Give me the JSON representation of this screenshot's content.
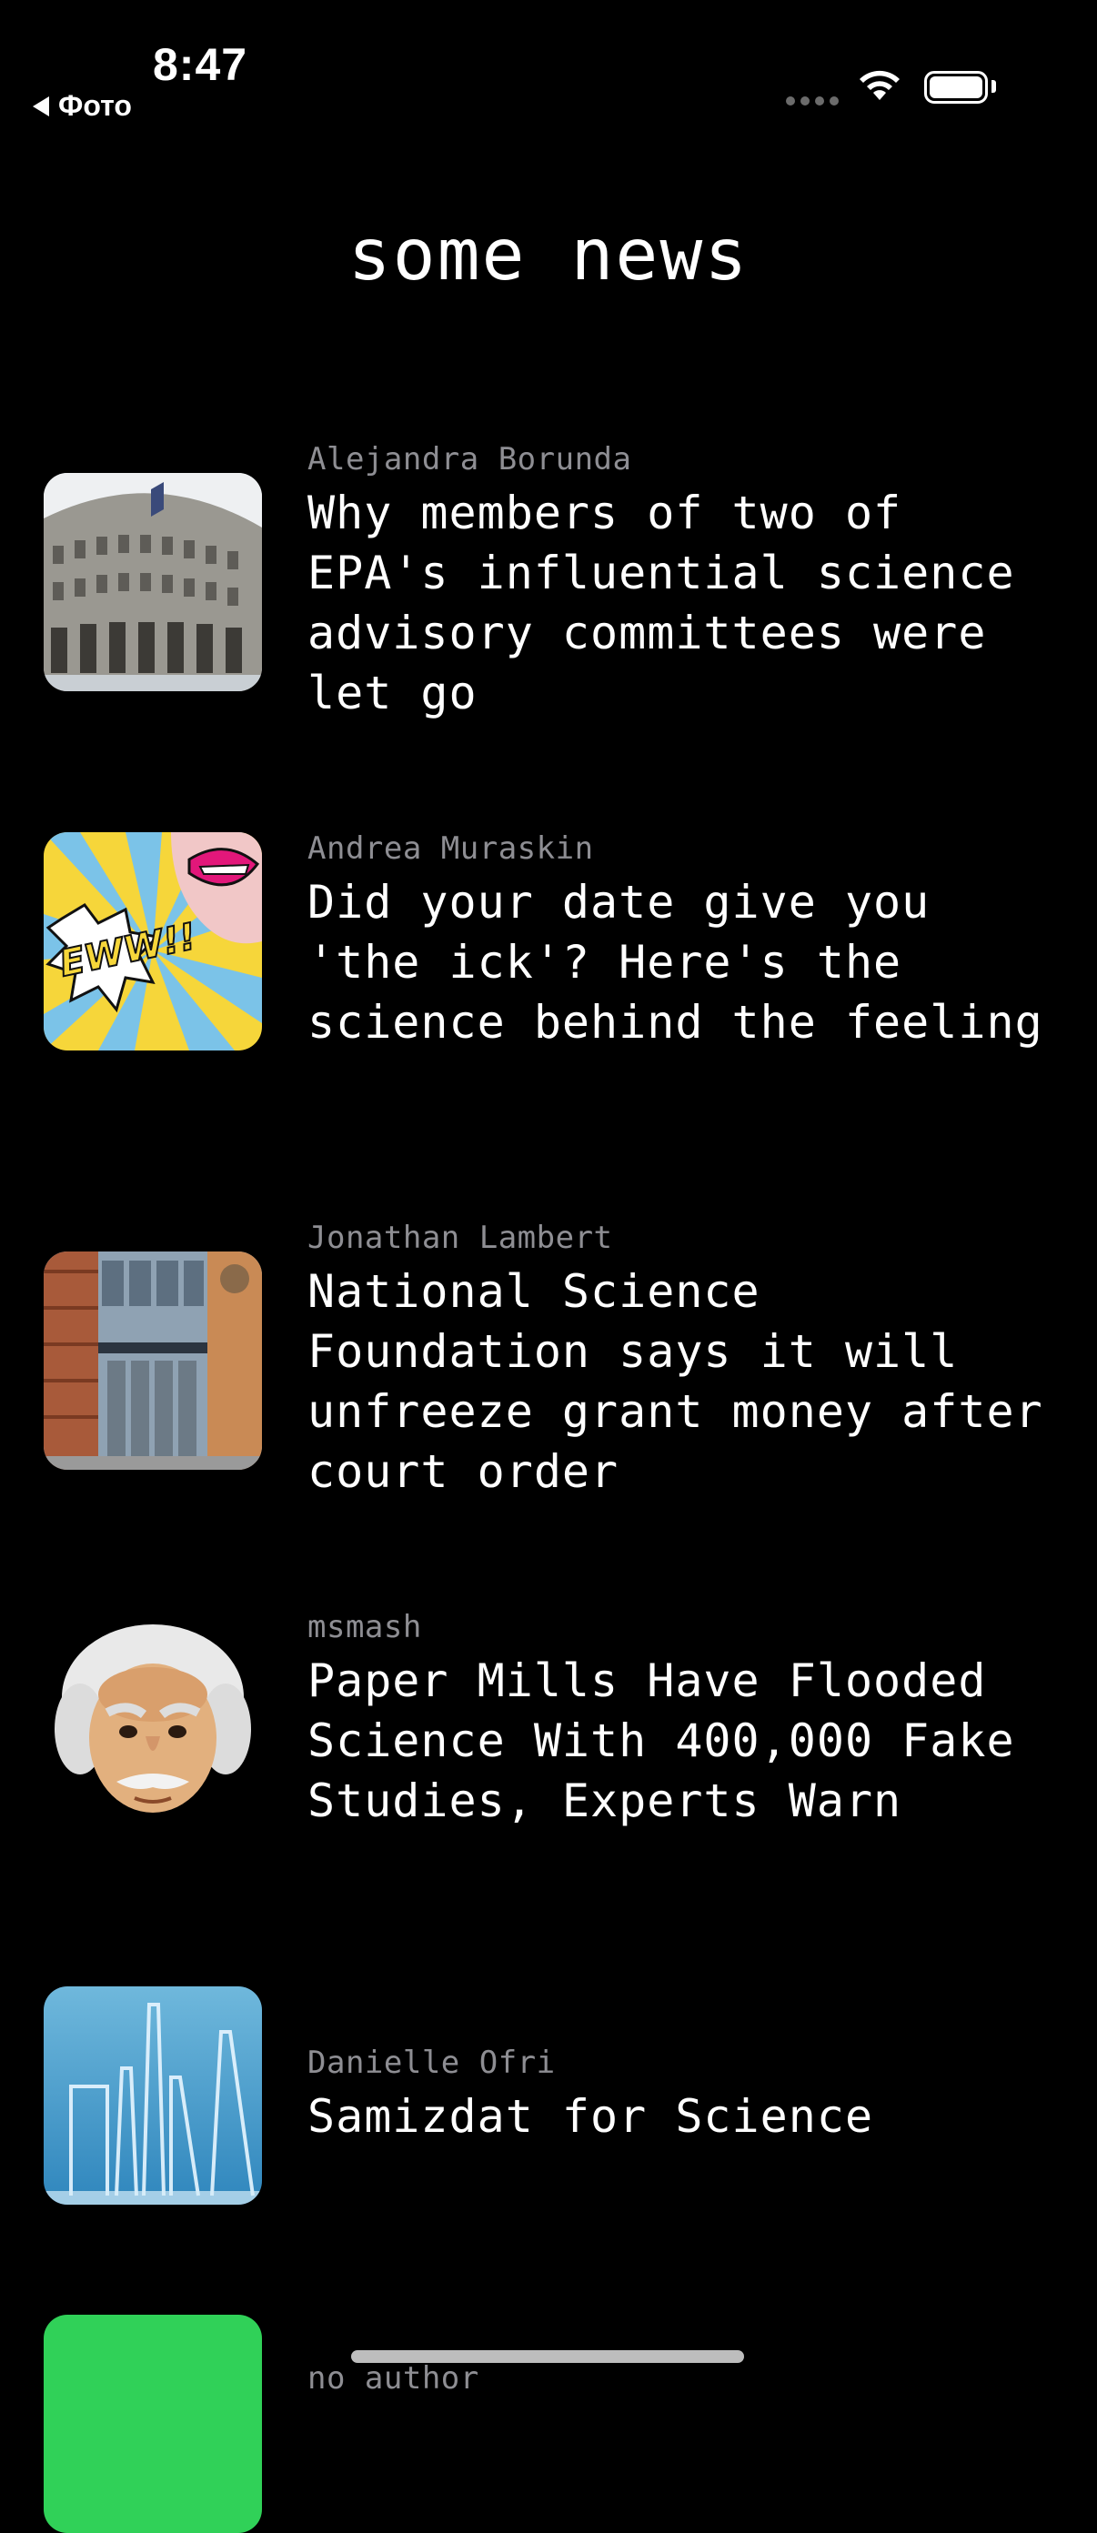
{
  "status_bar": {
    "time": "8:47",
    "back_label": "Фото",
    "icons": [
      "signal-dots-icon",
      "wifi-icon",
      "battery-icon"
    ]
  },
  "page": {
    "title": "some news"
  },
  "articles": [
    {
      "author": "Alejandra Borunda",
      "headline": "Why members of two of EPA's influential science advisory committees were let go",
      "thumbnail": "building-photo"
    },
    {
      "author": "Andrea Muraskin",
      "headline": "Did your date give you 'the ick'? Here's the science behind the feeling",
      "thumbnail": "pop-art-ewww"
    },
    {
      "author": "Jonathan Lambert",
      "headline": "National Science Foundation says it will unfreeze grant money after court order",
      "thumbnail": "nsf-building-photo"
    },
    {
      "author": "msmash",
      "headline": "Paper Mills Have Flooded Science With 400,000 Fake Studies, Experts Warn",
      "thumbnail": "einstein-emoji"
    },
    {
      "author": "Danielle Ofri",
      "headline": "Samizdat for Science",
      "thumbnail": "lab-glassware-photo"
    },
    {
      "author": "no author",
      "headline": "",
      "thumbnail": "green-placeholder"
    }
  ],
  "colors": {
    "background": "#000000",
    "text": "#ffffff",
    "author": "#8e8e93",
    "placeholder_green": "#30d158"
  }
}
